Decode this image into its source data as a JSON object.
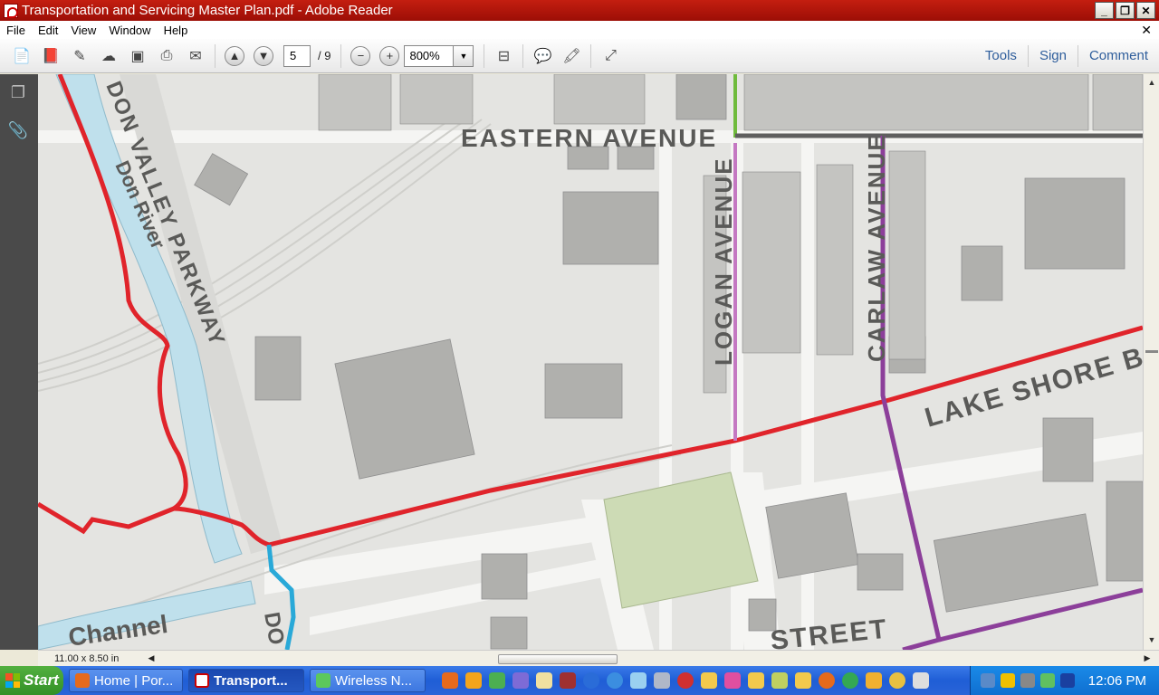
{
  "window": {
    "title": "Transportation and Servicing Master Plan.pdf - Adobe Reader",
    "minimize_icon": "minimize-icon",
    "restore_icon": "restore-icon",
    "close_icon": "close-icon"
  },
  "menu": {
    "items": [
      "File",
      "Edit",
      "View",
      "Window",
      "Help"
    ],
    "close_doc": "✕"
  },
  "toolbar": {
    "page_current": "5",
    "page_total": "/ 9",
    "zoom": "800%",
    "links": [
      "Tools",
      "Sign",
      "Comment"
    ]
  },
  "map": {
    "labels": {
      "eastern": "EASTERN AVENUE",
      "logan": "LOGAN AVENUE",
      "carlaw": "CARLAW AVENUE",
      "lakeshore": "LAKE SHORE BOU",
      "dvp": "DON VALLEY PARKWAY",
      "donriver": "Don River",
      "channel": "Channel",
      "street": "STREET",
      "don_partial": "DO"
    },
    "colors": {
      "red_route": "#e0242b",
      "purple_route": "#8c3f9a",
      "pink_route": "#c478c2",
      "blue_route": "#29a9d8",
      "green_route": "#6fbb3c",
      "water": "#bfe0ec",
      "park": "#cddbb5",
      "building": "#b0b0ad",
      "land": "#e4e4e1"
    }
  },
  "status": {
    "page_size": "11.00 x 8.50 in"
  },
  "taskbar": {
    "start": "Start",
    "tasks": [
      "Home | Por...",
      "Transport...",
      "Wireless N..."
    ],
    "clock": "12:06 PM"
  }
}
